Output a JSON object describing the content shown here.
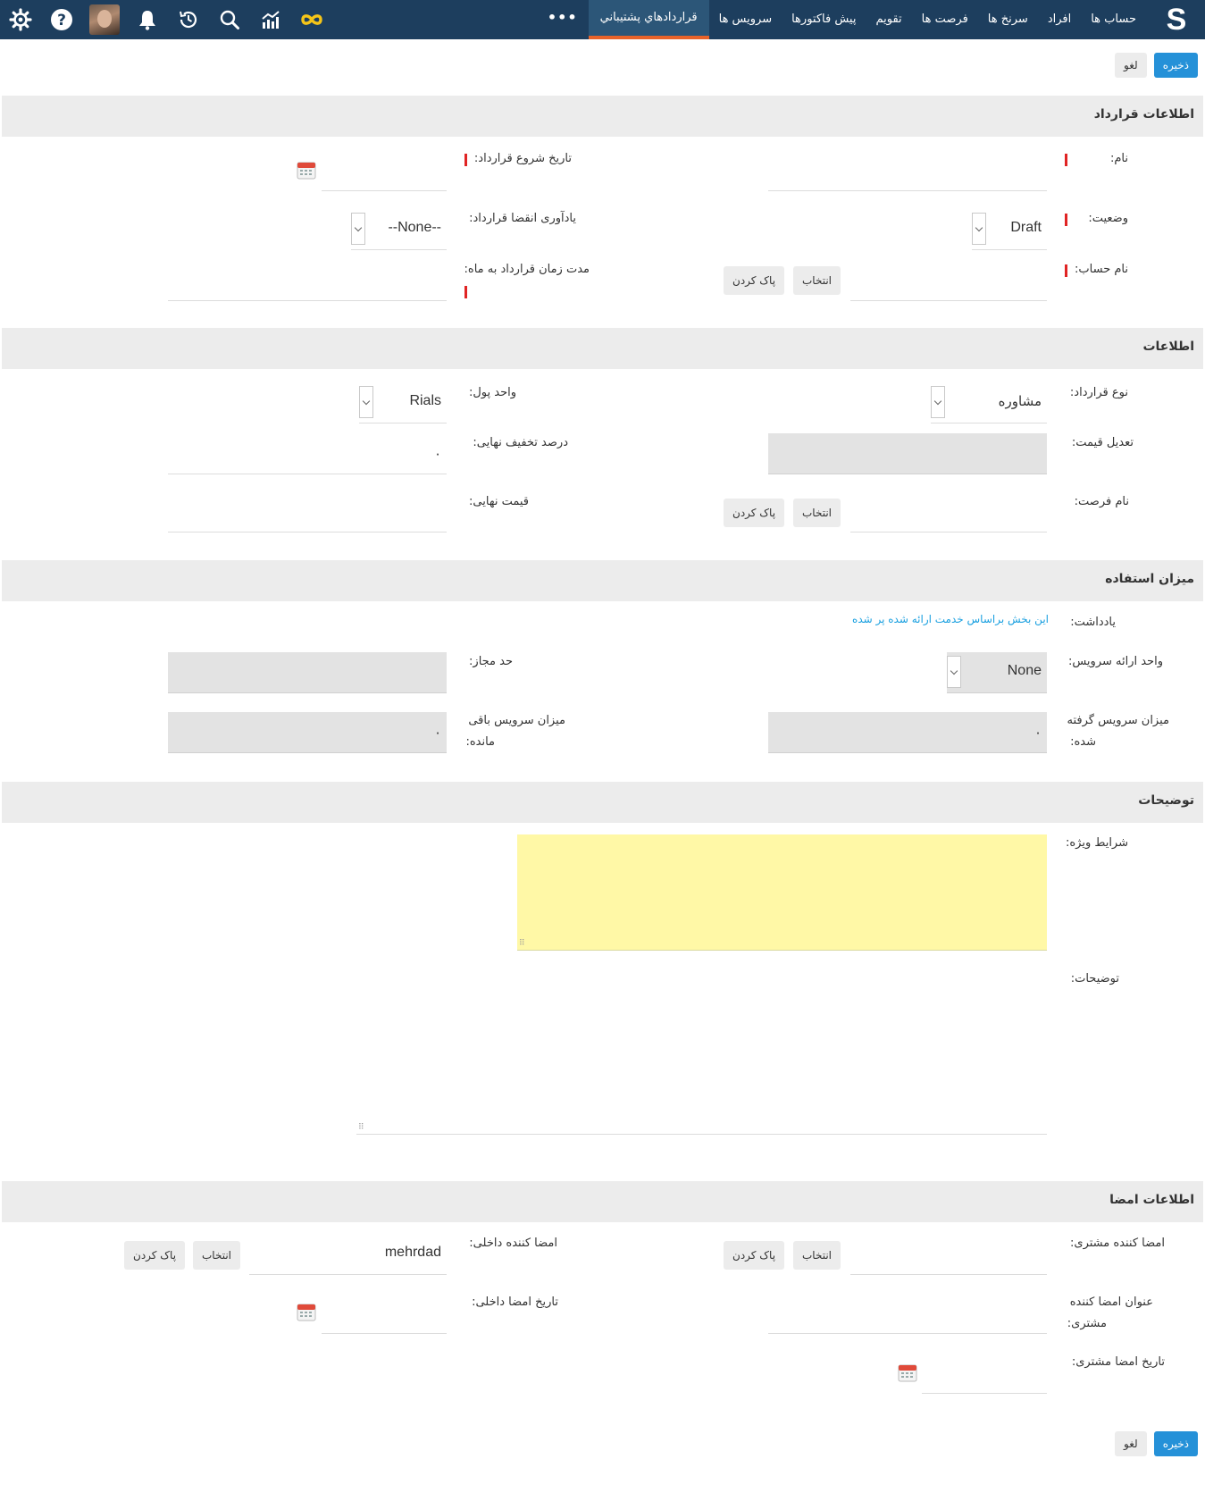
{
  "nav": {
    "logo": "S",
    "items": [
      "حساب ها",
      "افراد",
      "سرنخ ها",
      "فرصت ها",
      "تقویم",
      "پیش فاکتورها",
      "سرویس ها",
      "قراردادهاي پشتيباني"
    ],
    "more": "•••",
    "icons": [
      "infinity-icon",
      "chart-icon",
      "search-icon",
      "history-icon",
      "bell-icon",
      "avatar",
      "help-icon",
      "gear-icon"
    ]
  },
  "actions": {
    "save": "ذخیره",
    "cancel": "لغو"
  },
  "sections": {
    "contract_info": "اطلاعات قرارداد",
    "info": "اطلاعات",
    "usage": "میزان استفاده",
    "descriptions": "توضیحات",
    "signature_info": "اطلاعات امضا"
  },
  "labels": {
    "name": "نام:",
    "start_date": "تاریخ شروع قرارداد:",
    "status": "وضعیت:",
    "expiry_reminder": "یادآوری انقضا قرارداد:",
    "account_name": "نام حساب:",
    "duration_months": "مدت زمان قرارداد به ماه:",
    "contract_type": "نوع قرارداد:",
    "currency": "واحد پول:",
    "price_adjustment": "تعدیل قیمت:",
    "final_discount": "درصد تخفیف نهایی:",
    "opportunity_name": "نام فرصت:",
    "final_price": "قیمت نهایی:",
    "note": "یادداشت:",
    "service_unit": "واحد ارائه سرویس:",
    "allowed_limit": "حد مجاز:",
    "services_used_1": "میزان سرویس گرفته",
    "services_used_2": "شده:",
    "services_remaining_1": "میزان سرویس باقی",
    "services_remaining_2": "مانده:",
    "special_terms": "شرایط ویژه:",
    "description": "توضیحات:",
    "customer_signer": "امضا کننده مشتری:",
    "internal_signer": "امضا کننده داخلی:",
    "customer_signer_title_1": "عنوان امضا کننده",
    "customer_signer_title_2": "مشتری:",
    "internal_sign_date": "تاریخ امضا داخلی:",
    "customer_sign_date": "تاریخ امضا مشتری:"
  },
  "values": {
    "status": "Draft",
    "expiry_reminder": "--None--",
    "contract_type": "مشاوره",
    "currency": "Rials",
    "final_discount": "۰",
    "service_unit": "None",
    "services_used": "۰",
    "services_remaining": "۰",
    "internal_signer": "mehrdad"
  },
  "buttons": {
    "select": "انتخاب",
    "clear": "پاک کردن"
  },
  "note_text": "این بخش براساس خدمت ارائه شده پر شده",
  "colors": {
    "topbar": "#1d3e5e",
    "active_tab_underline": "#e8632a",
    "primary": "#2591d8",
    "required": "#e02424",
    "special_terms_bg": "#fff8a6",
    "link": "#1aa0e0"
  }
}
